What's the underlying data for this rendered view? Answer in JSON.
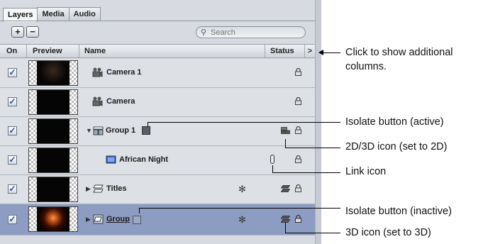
{
  "tabs": [
    {
      "label": "Layers",
      "active": true
    },
    {
      "label": "Media",
      "active": false
    },
    {
      "label": "Audio",
      "active": false
    }
  ],
  "toolbar": {
    "add_label": "+",
    "remove_label": "−"
  },
  "search": {
    "placeholder": "Search",
    "icon": "magnifier-icon"
  },
  "columns": {
    "on": "On",
    "preview": "Preview",
    "name": "Name",
    "status": "Status",
    "toggle": ">"
  },
  "rows": [
    {
      "name": "Camera 1",
      "icon": "camera-icon",
      "checked": true
    },
    {
      "name": "Camera",
      "icon": "camera-icon",
      "checked": true
    },
    {
      "name": "Group 1",
      "icon": "group-icon",
      "checked": true,
      "expanded": true
    },
    {
      "name": "African Night",
      "icon": "image-layer-icon",
      "checked": true
    },
    {
      "name": "Titles",
      "icon": "text-group-icon",
      "checked": true,
      "expanded": false
    },
    {
      "name": "Group",
      "icon": "group-3d-icon",
      "checked": true,
      "expanded": false,
      "selected": true
    }
  ],
  "callouts": {
    "show_columns": "Click to show additional columns.",
    "isolate_active": "Isolate button (active)",
    "icon_2d3d": "2D/3D icon (set to 2D)",
    "link": "Link icon",
    "isolate_inactive": "Isolate button (inactive)",
    "icon_3d": "3D icon (set to 3D)"
  },
  "colors": {
    "panel": "#d7dbe1",
    "selected_row": "#8d9cc2",
    "check": "#1c4fa8"
  }
}
